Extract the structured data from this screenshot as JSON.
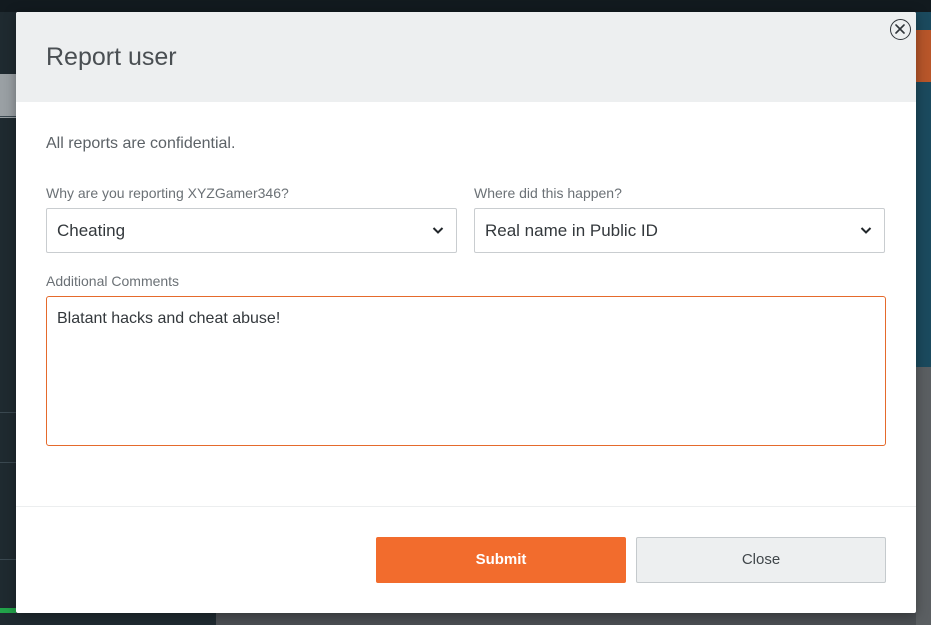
{
  "modal": {
    "title": "Report user",
    "confidential_note": "All reports are confidential.",
    "reason": {
      "label": "Why are you reporting XYZGamer346?",
      "selected": "Cheating"
    },
    "location": {
      "label": "Where did this happen?",
      "selected": "Real name in Public ID"
    },
    "comments": {
      "label": "Additional Comments",
      "value": "Blatant hacks and cheat abuse!"
    },
    "submit_label": "Submit",
    "close_label": "Close",
    "close_icon": "close-circle-icon"
  },
  "colors": {
    "accent": "#f26c2d",
    "header_bg": "#edeff0",
    "textarea_border": "#e56a2c"
  }
}
